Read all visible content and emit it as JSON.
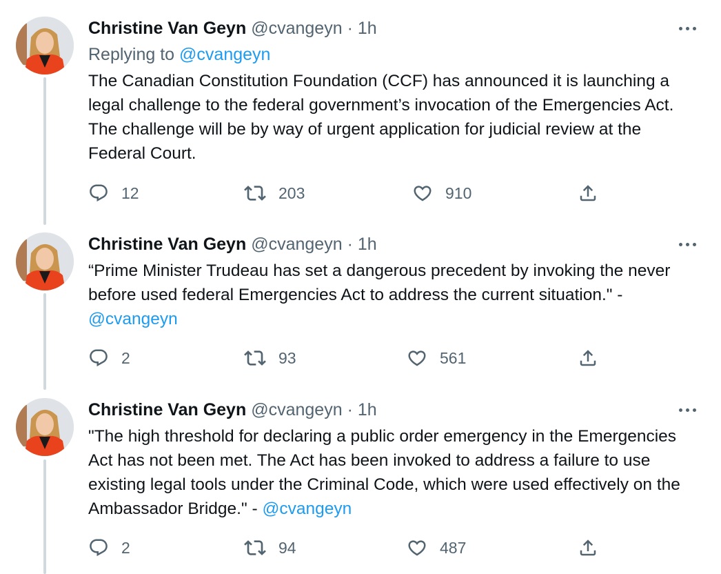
{
  "tweets": [
    {
      "author_name": "Christine Van Geyn",
      "author_handle": "@cvangeyn",
      "separator": "·",
      "time": "1h",
      "replying_prefix": "Replying to",
      "replying_handle": "@cvangeyn",
      "text": "The Canadian Constitution Foundation (CCF) has announced it is launching a legal challenge to the federal government’s invocation of the Emergencies Act. The challenge will be by way of urgent application for judicial review at the Federal Court.",
      "text_mention": "",
      "replies": "12",
      "retweets": "203",
      "likes": "910"
    },
    {
      "author_name": "Christine Van Geyn",
      "author_handle": "@cvangeyn",
      "separator": "·",
      "time": "1h",
      "text": "“Prime Minister Trudeau has set a dangerous precedent by invoking the never before used federal Emergencies Act to address the current situation.\" - ",
      "text_mention": "@cvangeyn",
      "replies": "2",
      "retweets": "93",
      "likes": "561"
    },
    {
      "author_name": "Christine Van Geyn",
      "author_handle": "@cvangeyn",
      "separator": "·",
      "time": "1h",
      "text": "\"The high threshold for declaring a public order emergency in the Emergencies Act has not been met. The Act has been invoked to address a failure to use existing legal tools under the Criminal Code, which were used effectively on the Ambassador Bridge.\" - ",
      "text_mention": "@cvangeyn",
      "replies": "2",
      "retweets": "94",
      "likes": "487"
    }
  ],
  "icons": {
    "reply": "reply-icon",
    "retweet": "retweet-icon",
    "like": "like-icon",
    "share": "share-icon",
    "more": "more-icon"
  },
  "colors": {
    "link": "#1d9bf0",
    "secondary_text": "#536471",
    "primary_text": "#0f1419",
    "thread_line": "#cfd9de",
    "avatar_jacket": "#e8431c"
  }
}
